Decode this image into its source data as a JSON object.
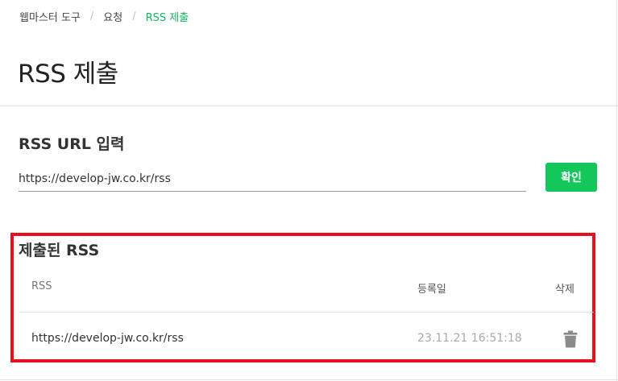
{
  "breadcrumb": {
    "items": [
      "웹마스터 도구",
      "요청",
      "RSS 제출"
    ],
    "separator": "/"
  },
  "page": {
    "title": "RSS 제출"
  },
  "url_input": {
    "section_title": "RSS URL 입력",
    "value": "https://develop-jw.co.kr/rss",
    "button_label": "확인"
  },
  "submitted": {
    "section_title": "제출된 RSS",
    "columns": [
      "RSS",
      "등록일",
      "삭제"
    ],
    "rows": [
      {
        "url": "https://develop-jw.co.kr/rss",
        "date": "23.11.21 16:51:18"
      }
    ],
    "highlight_color": "#e8101f"
  },
  "colors": {
    "accent": "#13c75b",
    "breadcrumb_current": "#13b45f",
    "delete_icon": "#8a8a8a"
  },
  "icons": {
    "delete": "trash-icon"
  }
}
